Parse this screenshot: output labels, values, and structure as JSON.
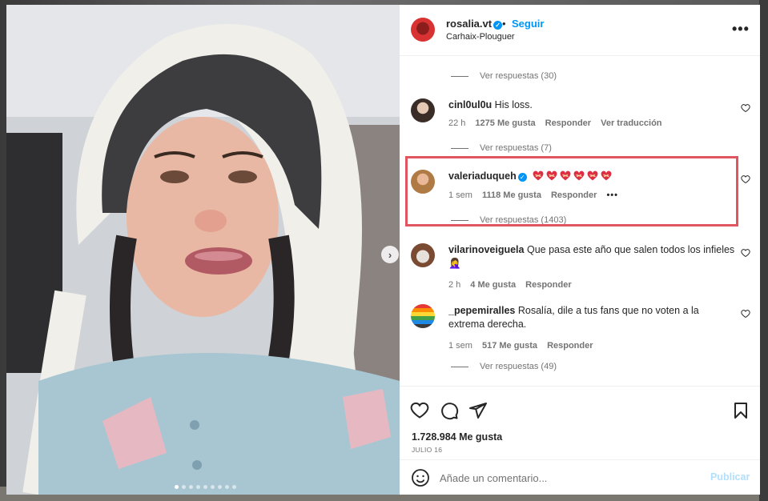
{
  "post": {
    "username": "rosalia.vt",
    "follow_label": "Seguir",
    "separator": "•",
    "location": "Carhaix-Plouguer",
    "more_label": "•••"
  },
  "comments": [
    {
      "replies_label": "Ver respuestas (30)"
    },
    {
      "username": "cinl0ul0u",
      "text": "His loss.",
      "time": "22 h",
      "likes": "1275 Me gusta",
      "reply_label": "Responder",
      "translate_label": "Ver traducción",
      "replies_label": "Ver respuestas (7)"
    },
    {
      "username": "valeriaduqueh",
      "hearts": [
        "mending-heart-icon",
        "mending-heart-icon",
        "mending-heart-icon",
        "mending-heart-icon",
        "mending-heart-icon",
        "mending-heart-icon"
      ],
      "time": "1 sem",
      "likes": "1118 Me gusta",
      "reply_label": "Responder",
      "more_label": "•••",
      "replies_label": "Ver respuestas (1403)"
    },
    {
      "username": "vilarinoveiguela",
      "text": "Que pasa este año que salen todos los infieles",
      "emoji": "🤦‍♀️",
      "time": "2 h",
      "likes": "4 Me gusta",
      "reply_label": "Responder"
    },
    {
      "username": "_pepemiralles",
      "text": "Rosalía, dile a tus fans que no voten a la extrema derecha.",
      "time": "1 sem",
      "likes": "517 Me gusta",
      "reply_label": "Responder",
      "replies_label": "Ver respuestas (49)"
    }
  ],
  "footer": {
    "likes": "1.728.984 Me gusta",
    "date": "JULIO 16",
    "comment_placeholder": "Añade un comentario...",
    "publish_label": "Publicar"
  },
  "colors": {
    "accent": "#0095f6",
    "highlight": "#e0555f",
    "publish_disabled": "#b2dffc"
  },
  "carousel": {
    "dot_count": 9,
    "active_index": 0
  }
}
